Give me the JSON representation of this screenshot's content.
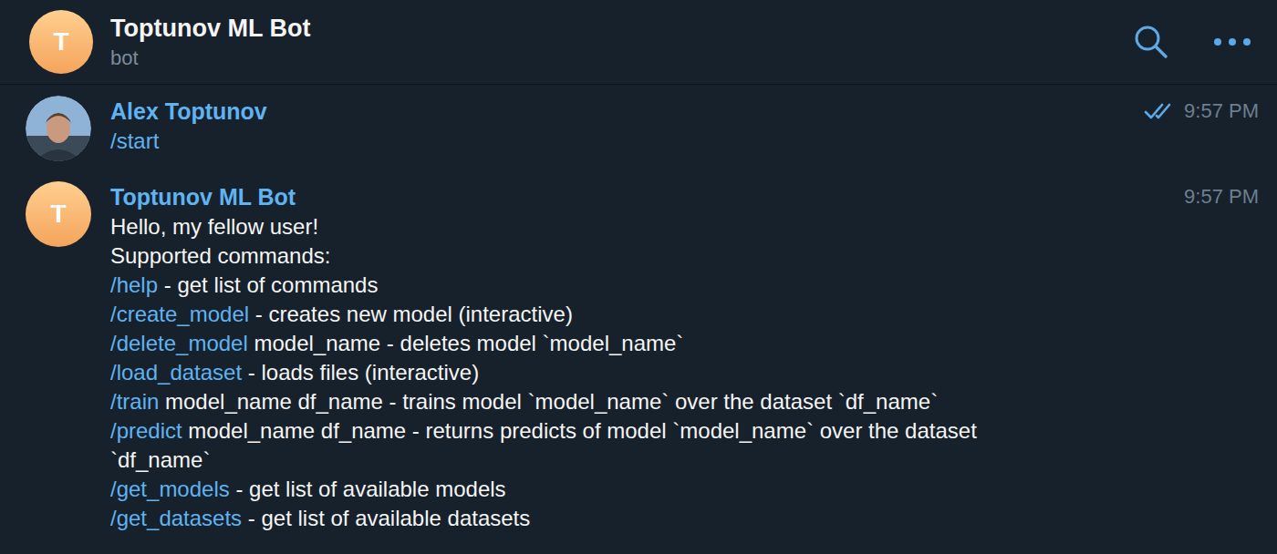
{
  "header": {
    "avatar_letter": "T",
    "title": "Toptunov ML Bot",
    "subtitle": "bot"
  },
  "messages": [
    {
      "author": "Alex Toptunov",
      "avatar_kind": "photo",
      "time": "9:57 PM",
      "read": true,
      "lines": [
        [
          {
            "text": "/start",
            "kind": "command"
          }
        ]
      ]
    },
    {
      "author": "Toptunov ML Bot",
      "avatar_kind": "letter",
      "avatar_letter": "T",
      "time": "9:57 PM",
      "lines": [
        [
          {
            "text": "Hello, my fellow user!",
            "kind": "text"
          }
        ],
        [
          {
            "text": "Supported commands:",
            "kind": "text"
          }
        ],
        [
          {
            "text": "/help",
            "kind": "command"
          },
          {
            "text": " - get list of commands",
            "kind": "text"
          }
        ],
        [
          {
            "text": "/create_model",
            "kind": "command"
          },
          {
            "text": " - creates new model (interactive)",
            "kind": "text"
          }
        ],
        [
          {
            "text": "/delete_model",
            "kind": "command"
          },
          {
            "text": " model_name - deletes model `model_name`",
            "kind": "text"
          }
        ],
        [
          {
            "text": "/load_dataset",
            "kind": "command"
          },
          {
            "text": " - loads files (interactive)",
            "kind": "text"
          }
        ],
        [
          {
            "text": "/train",
            "kind": "command"
          },
          {
            "text": " model_name df_name - trains model `model_name` over the dataset `df_name`",
            "kind": "text"
          }
        ],
        [
          {
            "text": "/predict",
            "kind": "command"
          },
          {
            "text": " model_name df_name - returns predicts of model `model_name` over the dataset",
            "kind": "text"
          }
        ],
        [
          {
            "text": "`df_name`",
            "kind": "text"
          }
        ],
        [
          {
            "text": "/get_models",
            "kind": "command"
          },
          {
            "text": " - get list of available models",
            "kind": "text"
          }
        ],
        [
          {
            "text": "/get_datasets",
            "kind": "command"
          },
          {
            "text": " - get list of available datasets",
            "kind": "text"
          }
        ]
      ]
    }
  ]
}
